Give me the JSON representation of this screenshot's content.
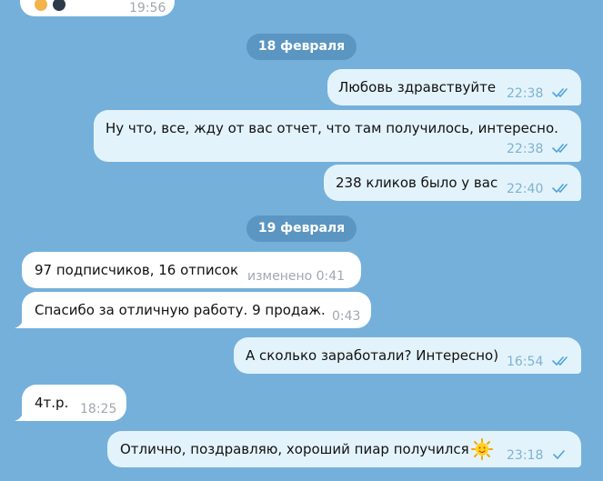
{
  "top_message": {
    "time": "19:56"
  },
  "dates": [
    "18 февраля",
    "19 февраля"
  ],
  "messages": [
    {
      "direction": "out",
      "text": "Любовь здравствуйте",
      "time": "22:38",
      "status": "read"
    },
    {
      "direction": "out",
      "text": "Ну что, все, жду от вас отчет, что там получилось, интересно.",
      "time": "22:38",
      "status": "read"
    },
    {
      "direction": "out",
      "text": "238 кликов было у вас",
      "time": "22:40",
      "status": "read"
    },
    {
      "direction": "in",
      "text": "97 подписчиков, 16 отписок",
      "time": "изменено 0:41"
    },
    {
      "direction": "in",
      "text": "Спасибо за отличную работу. 9 продаж.",
      "time": "0:43"
    },
    {
      "direction": "out",
      "text": "А сколько заработали? Интересно)",
      "time": "16:54",
      "status": "read"
    },
    {
      "direction": "in",
      "text": "4т.р.",
      "time": "18:25"
    },
    {
      "direction": "out",
      "text": "Отлично, поздравляю, хороший пиар получился",
      "time": "23:18",
      "status": "sent",
      "emoji": "sun-emoji-icon"
    }
  ],
  "colors": {
    "background": "#75b0db",
    "incoming_bubble": "#ffffff",
    "outgoing_bubble": "#e3f3fc",
    "date_pill": "#5b96c2",
    "read_ticks": "#4fa3d8"
  }
}
